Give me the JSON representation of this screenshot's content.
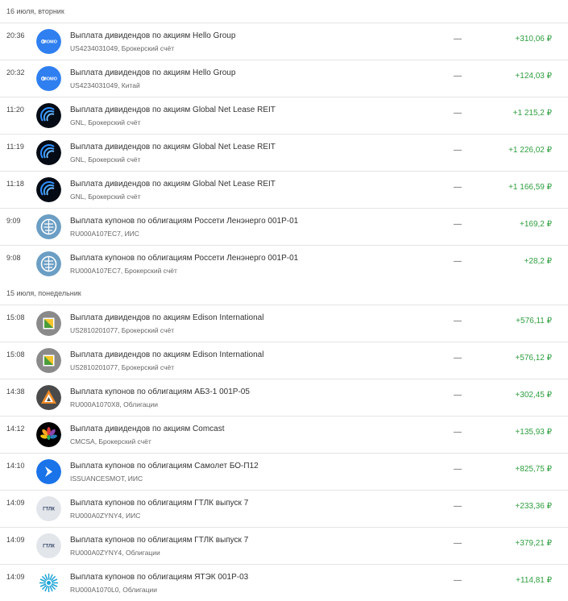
{
  "accent_positive": "#2e9e3f",
  "groups": [
    {
      "date": "16 июля, вторник",
      "ops": [
        {
          "time": "20:36",
          "title": "Выплата дивидендов по акциям Hello Group",
          "sub": "US4234031049, Брокерский счёт",
          "dash": "—",
          "amount": "+310,06 ₽",
          "icon": "momo-logo"
        },
        {
          "time": "20:32",
          "title": "Выплата дивидендов по акциям Hello Group",
          "sub": "US4234031049, Китай",
          "dash": "—",
          "amount": "+124,03 ₽",
          "icon": "momo-logo"
        },
        {
          "time": "11:20",
          "title": "Выплата дивидендов по акциям Global Net Lease REIT",
          "sub": "GNL, Брокерский счёт",
          "dash": "—",
          "amount": "+1 215,2 ₽",
          "icon": "gnl-logo"
        },
        {
          "time": "11:19",
          "title": "Выплата дивидендов по акциям Global Net Lease REIT",
          "sub": "GNL, Брокерский счёт",
          "dash": "—",
          "amount": "+1 226,02 ₽",
          "icon": "gnl-logo"
        },
        {
          "time": "11:18",
          "title": "Выплата дивидендов по акциям Global Net Lease REIT",
          "sub": "GNL, Брокерский счёт",
          "dash": "—",
          "amount": "+1 166,59 ₽",
          "icon": "gnl-logo"
        },
        {
          "time": "9:09",
          "title": "Выплата купонов по облигациям Россети Ленэнерго 001Р-01",
          "sub": "RU000A107EC7, ИИС",
          "dash": "—",
          "amount": "+169,2 ₽",
          "icon": "rosseti-logo"
        },
        {
          "time": "9:08",
          "title": "Выплата купонов по облигациям Россети Ленэнерго 001Р-01",
          "sub": "RU000A107EC7, Брокерский счёт",
          "dash": "—",
          "amount": "+28,2 ₽",
          "icon": "rosseti-logo"
        }
      ]
    },
    {
      "date": "15 июля, понедельник",
      "ops": [
        {
          "time": "15:08",
          "title": "Выплата дивидендов по акциям Edison International",
          "sub": "US2810201077, Брокерский счёт",
          "dash": "—",
          "amount": "+576,11 ₽",
          "icon": "edison-logo"
        },
        {
          "time": "15:08",
          "title": "Выплата дивидендов по акциям Edison International",
          "sub": "US2810201077, Брокерский счёт",
          "dash": "—",
          "amount": "+576,12 ₽",
          "icon": "edison-logo"
        },
        {
          "time": "14:38",
          "title": "Выплата купонов по облигациям АБЗ-1 001Р-05",
          "sub": "RU000A1070X8, Облигации",
          "dash": "—",
          "amount": "+302,45 ₽",
          "icon": "abz-logo"
        },
        {
          "time": "14:12",
          "title": "Выплата дивидендов по акциям Comcast",
          "sub": "CMCSA, Брокерский счёт",
          "dash": "—",
          "amount": "+135,93 ₽",
          "icon": "comcast-logo"
        },
        {
          "time": "14:10",
          "title": "Выплата купонов по облигациям Самолет БО-П12",
          "sub": "ISSUANCESMOT, ИИС",
          "dash": "—",
          "amount": "+825,75 ₽",
          "icon": "samolet-logo"
        },
        {
          "time": "14:09",
          "title": "Выплата купонов по облигациям ГТЛК выпуск 7",
          "sub": "RU000A0ZYNY4, ИИС",
          "dash": "—",
          "amount": "+233,36 ₽",
          "icon": "gtlk-logo"
        },
        {
          "time": "14:09",
          "title": "Выплата купонов по облигациям ГТЛК выпуск 7",
          "sub": "RU000A0ZYNY4, Облигации",
          "dash": "—",
          "amount": "+379,21 ₽",
          "icon": "gtlk-logo"
        },
        {
          "time": "14:09",
          "title": "Выплата купонов по облигациям ЯТЭК 001Р-03",
          "sub": "RU000A1070L0, Облигации",
          "dash": "—",
          "amount": "+114,81 ₽",
          "icon": "yatek-logo"
        }
      ]
    }
  ]
}
